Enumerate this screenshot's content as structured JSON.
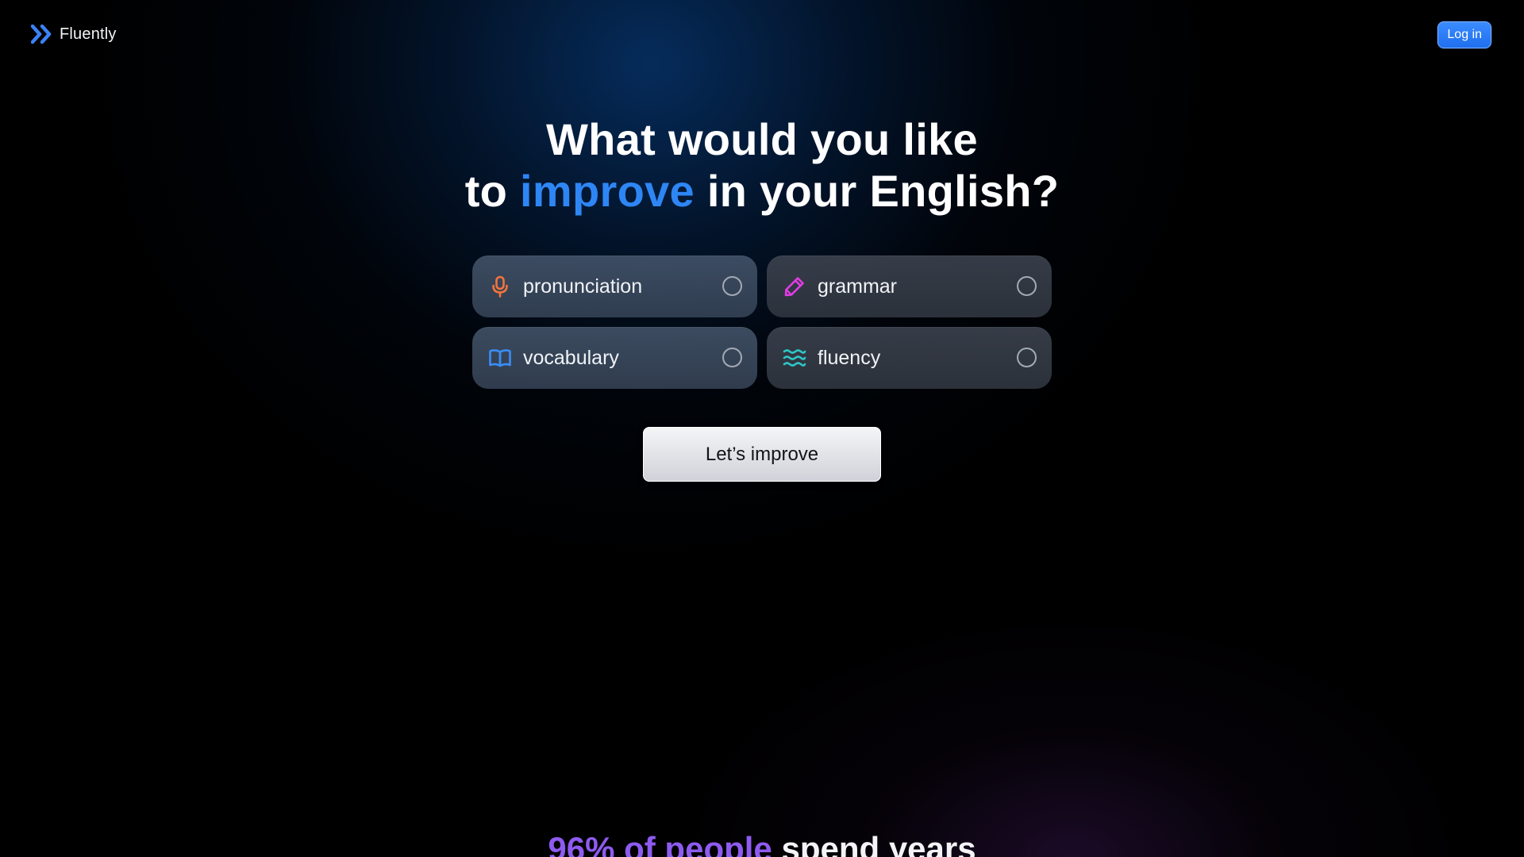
{
  "header": {
    "brand": "Fluently",
    "login_label": "Log in"
  },
  "hero": {
    "line1": "What would you like",
    "line2_prefix": "to ",
    "line2_accent": "improve",
    "line2_suffix": " in your English?"
  },
  "options": [
    {
      "label": "pronunciation",
      "icon": "microphone-icon",
      "icon_color": "#f2743a",
      "selected": false
    },
    {
      "label": "grammar",
      "icon": "pencil-icon",
      "icon_color": "#e33ce6",
      "selected": false
    },
    {
      "label": "vocabulary",
      "icon": "open-book-icon",
      "icon_color": "#3a8df5",
      "selected": false
    },
    {
      "label": "fluency",
      "icon": "waves-icon",
      "icon_color": "#2ec6c6",
      "selected": false
    }
  ],
  "cta": {
    "label": "Let’s improve"
  },
  "teaser": {
    "accent": "96% of people",
    "rest": " spend years"
  },
  "colors": {
    "accent_blue": "#2e86f5",
    "accent_purple": "#8e5bf0",
    "login_bg": "#2a7df7"
  }
}
